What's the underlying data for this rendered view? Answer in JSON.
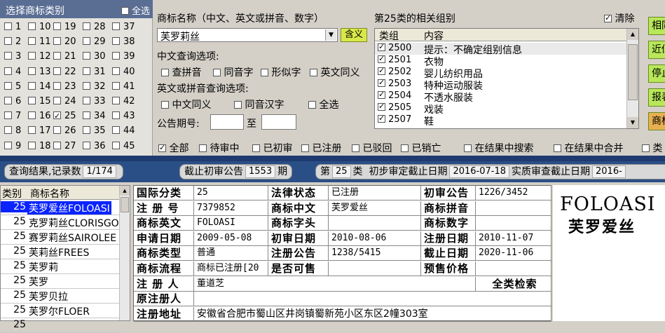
{
  "category_panel": {
    "title": "选择商标类别",
    "select_all": "全选",
    "columns": [
      [
        "1",
        "2",
        "3",
        "4",
        "5",
        "6",
        "7",
        "8",
        "9"
      ],
      [
        "10",
        "11",
        "12",
        "13",
        "14",
        "15",
        "16",
        "17",
        "18"
      ],
      [
        "19",
        "20",
        "21",
        "22",
        "23",
        "24",
        "25",
        "26",
        "27"
      ],
      [
        "28",
        "29",
        "30",
        "31",
        "32",
        "33",
        "34",
        "35",
        "36"
      ],
      [
        "37",
        "38",
        "39",
        "40",
        "41",
        "42",
        "43",
        "44",
        "45"
      ]
    ],
    "checked": [
      "25"
    ]
  },
  "query": {
    "name_label": "商标名称（中文、英文或拼音、数字）",
    "name_value": "芙罗莉丝",
    "meaning_button": "含义",
    "chinese_options_label": "中文查询选项:",
    "chinese_options": [
      "查拼音",
      "同音字",
      "形似字",
      "英文同义"
    ],
    "english_options_label": "英文或拼音查询选项:",
    "english_options": [
      "中文同义",
      "同音汉字",
      "全选"
    ],
    "gazette_label": "公告期号:",
    "gazette_to": "至"
  },
  "groups": {
    "title": "第25类的相关组别",
    "clear": "清除",
    "header_group": "类组",
    "header_content": "内容",
    "rows": [
      {
        "code": "2500",
        "desc": "提示：不确定组别信息"
      },
      {
        "code": "2501",
        "desc": "衣物"
      },
      {
        "code": "2502",
        "desc": "婴儿纺织用品"
      },
      {
        "code": "2503",
        "desc": "特种运动服装"
      },
      {
        "code": "2504",
        "desc": "不透水服装"
      },
      {
        "code": "2505",
        "desc": "戏装"
      },
      {
        "code": "2507",
        "desc": "鞋"
      }
    ]
  },
  "right_buttons": [
    {
      "label": "相同",
      "color": "#b8e85a"
    },
    {
      "label": "近似",
      "color": "#b8e85a"
    },
    {
      "label": "停止",
      "color": "#b8e85a"
    },
    {
      "label": "报表",
      "color": "#b8e85a"
    },
    {
      "label": "商标",
      "color": "#e8b050"
    }
  ],
  "filters": {
    "items": [
      "全部",
      "待审中",
      "已初审",
      "已注册",
      "已驳回",
      "已销亡",
      "在结果中搜索",
      "在结果中合并",
      "类"
    ],
    "checked": [
      "全部"
    ]
  },
  "status": {
    "result_label": "查询结果,记录数",
    "result_value": "1/174",
    "cutoff_label": "截止初审公告",
    "cutoff_value": "1553",
    "cutoff_unit": "期",
    "class_prefix": "第",
    "class_value": "25",
    "class_suffix": "类",
    "prelim_label": "初步审定截止日期",
    "prelim_value": "2016-07-18",
    "exam_label": "实质审查截止日期",
    "exam_value": "2016-"
  },
  "result_list": {
    "header_class": "类别",
    "header_name": "商标名称",
    "rows": [
      {
        "cls": "25",
        "name": "芙罗爱丝FOLOASI"
      },
      {
        "cls": "25",
        "name": "克罗莉丝CLORISGO"
      },
      {
        "cls": "25",
        "name": "赛罗莉丝SAIROLEE"
      },
      {
        "cls": "25",
        "name": "芙莉丝FREES"
      },
      {
        "cls": "25",
        "name": "芙罗莉"
      },
      {
        "cls": "25",
        "name": "芙罗"
      },
      {
        "cls": "25",
        "name": "芙罗贝拉"
      },
      {
        "cls": "25",
        "name": "芙罗尔FLOER"
      },
      {
        "cls": "25",
        "name": ""
      }
    ]
  },
  "detail": {
    "r1": {
      "k1": "国际分类",
      "v1": "25",
      "k2": "法律状态",
      "v2": "已注册",
      "k3": "初审公告",
      "v3": "1226/3452"
    },
    "r2": {
      "k1": "注 册 号",
      "v1": "7379852",
      "k2": "商标中文",
      "v2": "芙罗爱丝",
      "k3": "商标拼音",
      "v3": ""
    },
    "r3": {
      "k1": "商标英文",
      "v1": "FOLOASI",
      "k2": "商标字头",
      "v2": "",
      "k3": "商标数字",
      "v3": ""
    },
    "r4": {
      "k1": "申请日期",
      "v1": "2009-05-08",
      "k2": "初审日期",
      "v2": "2010-08-06",
      "k3": "注册日期",
      "v3": "2010-11-07"
    },
    "r5": {
      "k1": "商标类型",
      "v1": "普通",
      "k2": "注册公告",
      "v2": "1238/5415",
      "k3": "截止日期",
      "v3": "2020-11-06"
    },
    "r6": {
      "k1": "商标流程",
      "v1": "商标已注册[20",
      "k2": "是否可售",
      "v2": "",
      "k3": "预售价格",
      "v3": ""
    },
    "r7": {
      "k1": "注 册 人",
      "v1": "董道芝",
      "k3": "全类检索"
    },
    "r8": {
      "k1": "原注册人",
      "v1": ""
    },
    "r9": {
      "k1": "注册地址",
      "v1": "安徽省合肥市蜀山区井岗镇蜀新苑小区东区2幢303室"
    }
  },
  "logo": {
    "en": "FOLOASI",
    "zh": "芙罗爱丝"
  }
}
